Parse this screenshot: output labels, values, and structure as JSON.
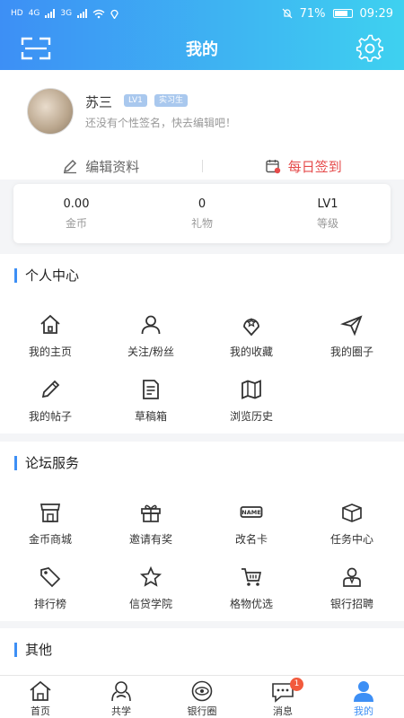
{
  "status_bar": {
    "network": "HD",
    "signal1": "4G",
    "signal2": "3G",
    "battery": "71%",
    "time": "09:29"
  },
  "header": {
    "title": "我的"
  },
  "profile": {
    "name": "苏三",
    "level_badge": "LV1",
    "role_badge": "实习生",
    "bio": "还没有个性签名，快去编辑吧！",
    "edit_label": "编辑资料",
    "checkin_label": "每日签到"
  },
  "stats": [
    {
      "value": "0.00",
      "label": "金币"
    },
    {
      "value": "0",
      "label": "礼物"
    },
    {
      "value": "LV1",
      "label": "等级"
    }
  ],
  "personal_center": {
    "title": "个人中心",
    "items": [
      {
        "label": "我的主页",
        "icon": "home-icon"
      },
      {
        "label": "关注/粉丝",
        "icon": "person-icon"
      },
      {
        "label": "我的收藏",
        "icon": "favorite-icon"
      },
      {
        "label": "我的圈子",
        "icon": "paper-plane-icon"
      },
      {
        "label": "我的帖子",
        "icon": "pencil-icon"
      },
      {
        "label": "草稿箱",
        "icon": "draft-icon"
      },
      {
        "label": "浏览历史",
        "icon": "map-icon"
      }
    ]
  },
  "forum_services": {
    "title": "论坛服务",
    "items": [
      {
        "label": "金币商城",
        "icon": "shop-icon"
      },
      {
        "label": "邀请有奖",
        "icon": "gift-icon"
      },
      {
        "label": "改名卡",
        "icon": "name-card-icon",
        "card_text": "NAME"
      },
      {
        "label": "任务中心",
        "icon": "box-icon"
      },
      {
        "label": "排行榜",
        "icon": "tag-icon"
      },
      {
        "label": "信贷学院",
        "icon": "star-icon"
      },
      {
        "label": "格物优选",
        "icon": "cart-icon"
      },
      {
        "label": "银行招聘",
        "icon": "recruit-icon"
      }
    ]
  },
  "other": {
    "title": "其他"
  },
  "tabs": [
    {
      "label": "首页",
      "icon": "home-tab-icon"
    },
    {
      "label": "共学",
      "icon": "study-tab-icon"
    },
    {
      "label": "银行圈",
      "icon": "circle-tab-icon"
    },
    {
      "label": "消息",
      "icon": "message-tab-icon",
      "badge": "1"
    },
    {
      "label": "我的",
      "icon": "me-tab-icon",
      "active": true
    }
  ],
  "colors": {
    "accent": "#3d8ff5",
    "accent2": "#3ed1f0",
    "checkin": "#e54b4b",
    "badge": "#f25a3c"
  }
}
